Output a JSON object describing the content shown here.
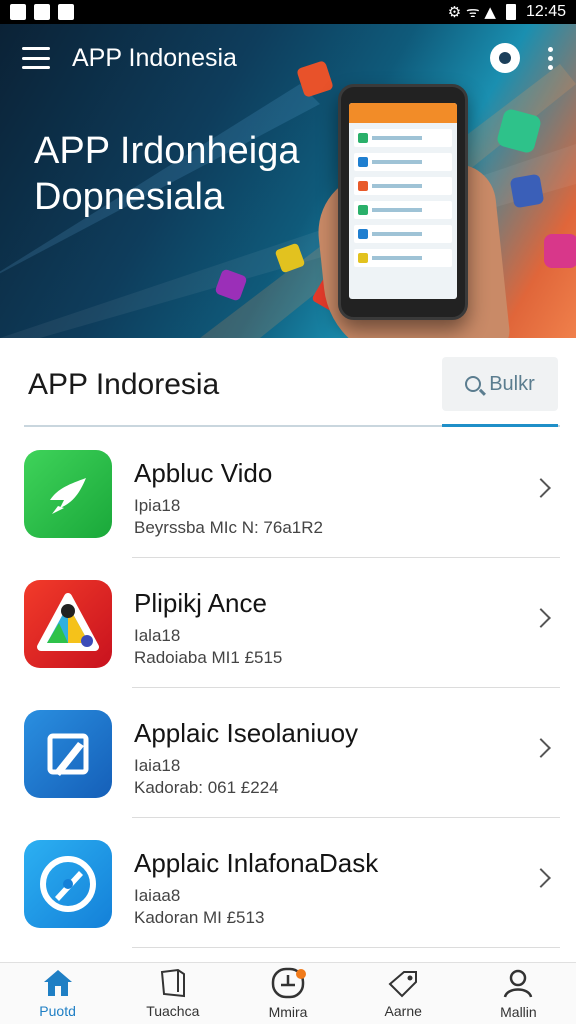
{
  "status_bar": {
    "time": "12:45",
    "right_glyphs": "⚙ ᯤ ▲"
  },
  "header": {
    "title": "APP Indonesia",
    "hero_title_line1": "APP Irdonheiga",
    "hero_title_line2": "Dopnesiala"
  },
  "section": {
    "title": "APP Indoresia",
    "search_label": "Bulkr"
  },
  "apps": [
    {
      "title": "Apbluc Vido",
      "line1": "Ipia18",
      "line2": "Beyrssba MIc N: 76a1R2",
      "icon": "bird-icon",
      "color": "#2fbd4a"
    },
    {
      "title": "Plipikj Ance",
      "line1": "Iala18",
      "line2": "Radoiaba MI1 £515",
      "icon": "triangle-icon",
      "color": "#e8262a"
    },
    {
      "title": "Applaic Iseolaniuoy",
      "line1": "Iaia18",
      "line2": "Kadorab: 061 £224",
      "icon": "edit-icon",
      "color": "#1f7fd0"
    },
    {
      "title": "Applaic InlafonaDask",
      "line1": "Iaiaa8",
      "line2": "Kadoran MI £513",
      "icon": "compass-icon",
      "color": "#1e9be6"
    }
  ],
  "bottom_nav": [
    {
      "label": "Puotd",
      "icon": "home-icon",
      "active": true
    },
    {
      "label": "Tuachca",
      "icon": "book-icon",
      "active": false
    },
    {
      "label": "Mmira",
      "icon": "chart-icon",
      "active": false
    },
    {
      "label": "Aarne",
      "icon": "tag-icon",
      "active": false
    },
    {
      "label": "Mallin",
      "icon": "profile-icon",
      "active": false
    }
  ],
  "colors": {
    "accent": "#1f8fc8",
    "nav_active": "#1f7fc4"
  }
}
